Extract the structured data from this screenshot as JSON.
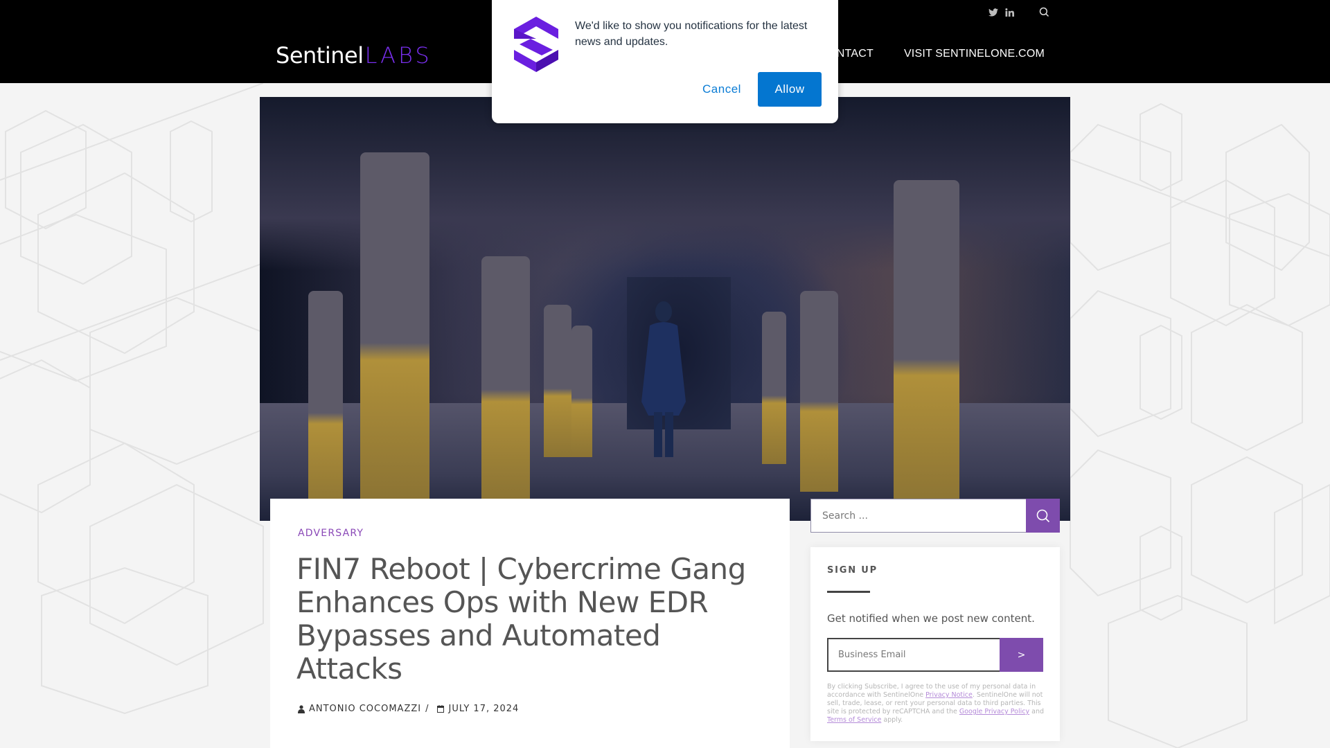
{
  "header": {
    "logo_primary": "Sentinel",
    "logo_secondary": "LABS",
    "social": [
      "twitter-icon",
      "linkedin-icon"
    ],
    "nav": [
      {
        "label": "CONTACT"
      },
      {
        "label": "VISIT SENTINELONE.COM"
      }
    ]
  },
  "notification": {
    "message": "We'd like to show you notifications for the latest news and updates.",
    "cancel_label": "Cancel",
    "allow_label": "Allow"
  },
  "article": {
    "category": "ADVERSARY",
    "title": "FIN7 Reboot | Cybercrime Gang Enhances Ops with New EDR Bypasses and Automated Attacks",
    "author": "ANTONIO COCOMAZZI",
    "separator": "/",
    "date": "JULY 17, 2024"
  },
  "sidebar": {
    "search": {
      "placeholder": "Search ..."
    },
    "signup": {
      "title": "SIGN UP",
      "description": "Get notified when we post new content.",
      "email_placeholder": "Business Email",
      "submit_label": ">",
      "legal": {
        "part1": "By clicking Subscribe, I agree to the use of my personal data in accordance with SentinelOne ",
        "link1": "Privacy Notice",
        "part2": ". SentinelOne will not sell, trade, lease, or rent your personal data to third parties. This site is protected by reCAPTCHA and the ",
        "link2": "Google Privacy Policy",
        "part3": " and ",
        "link3": "Terms of Service",
        "part4": " apply."
      }
    }
  },
  "colors": {
    "brand_purple": "#7e4cad",
    "logo_purple": "#7a2ff0",
    "allow_blue": "#0476d0",
    "header_bg": "#000000",
    "page_bg": "#f4f4f4"
  }
}
